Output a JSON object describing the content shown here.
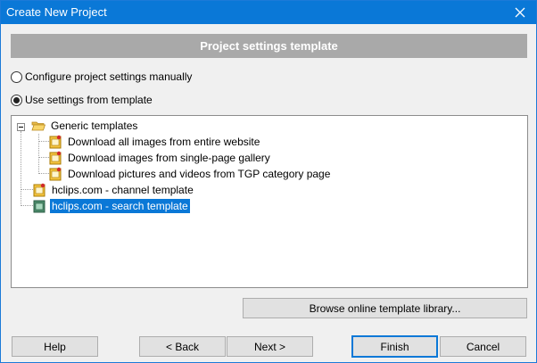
{
  "window": {
    "title": "Create New Project"
  },
  "header": {
    "title": "Project settings template"
  },
  "options": {
    "manual_label": "Configure project settings manually",
    "template_label": "Use settings from template",
    "selected": "template"
  },
  "tree": {
    "root": {
      "label": "Generic templates",
      "expanded": true,
      "icon": "folder-open-icon"
    },
    "children": [
      {
        "label": "Download all images from entire website",
        "icon": "template-file-icon"
      },
      {
        "label": "Download images from single-page gallery",
        "icon": "template-file-icon"
      },
      {
        "label": "Download pictures and videos from TGP category page",
        "icon": "template-file-icon"
      }
    ],
    "items": [
      {
        "label": "hclips.com - channel template",
        "icon": "template-file-icon"
      },
      {
        "label": "hclips.com - search template",
        "icon": "template-file-green-icon",
        "selected": true
      }
    ]
  },
  "buttons": {
    "browse": "Browse online template library...",
    "help": "Help",
    "back": "< Back",
    "next": "Next >",
    "finish": "Finish",
    "cancel": "Cancel"
  },
  "colors": {
    "titlebar": "#0a78d7",
    "header_band": "#a9a9a9",
    "selection": "#0a78d7"
  }
}
